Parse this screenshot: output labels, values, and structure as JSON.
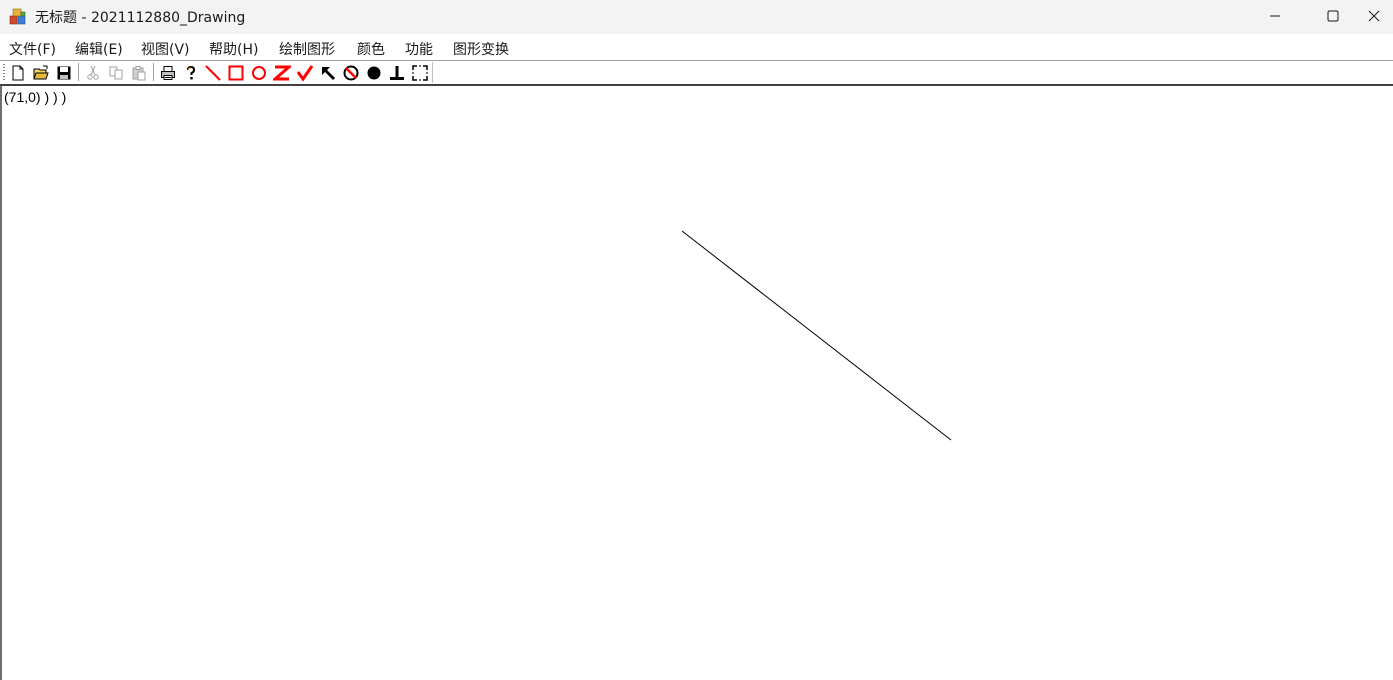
{
  "window": {
    "title": "无标题 - 2021112880_Drawing",
    "icon": "app-blocks-icon"
  },
  "window_controls": {
    "minimize_icon": "minimize-icon",
    "maximize_icon": "maximize-icon",
    "close_icon": "close-icon"
  },
  "menu": {
    "file": "文件(F)",
    "edit": "编辑(E)",
    "view": "视图(V)",
    "help": "帮助(H)",
    "draw_shapes": "绘制图形",
    "color": "颜色",
    "function": "功能",
    "transform": "图形变换"
  },
  "toolbar": {
    "buttons": [
      {
        "icon": "new-file-icon",
        "enabled": true
      },
      {
        "icon": "open-folder-icon",
        "enabled": true
      },
      {
        "icon": "save-icon",
        "enabled": true
      },
      {
        "icon": "cut-icon",
        "enabled": false
      },
      {
        "icon": "copy-icon",
        "enabled": false
      },
      {
        "icon": "paste-icon",
        "enabled": false
      },
      {
        "icon": "print-icon",
        "enabled": true
      },
      {
        "icon": "help-icon",
        "enabled": true
      },
      {
        "icon": "line-tool-icon",
        "enabled": true
      },
      {
        "icon": "rectangle-tool-icon",
        "enabled": true
      },
      {
        "icon": "circle-tool-icon",
        "enabled": true
      },
      {
        "icon": "polyline-z-tool-icon",
        "enabled": true
      },
      {
        "icon": "polyline-v-tool-icon",
        "enabled": true
      },
      {
        "icon": "arrow-tool-icon",
        "enabled": true
      },
      {
        "icon": "fill-tool-icon",
        "enabled": true
      },
      {
        "icon": "filled-circle-tool-icon",
        "enabled": true
      },
      {
        "icon": "perpendicular-tool-icon",
        "enabled": true
      },
      {
        "icon": "select-region-tool-icon",
        "enabled": true
      }
    ],
    "accent_color": "#ff0000"
  },
  "canvas": {
    "coordinate_readout": "(71,0) ) ) )",
    "line_color": "#000000",
    "background": "#ffffff"
  }
}
